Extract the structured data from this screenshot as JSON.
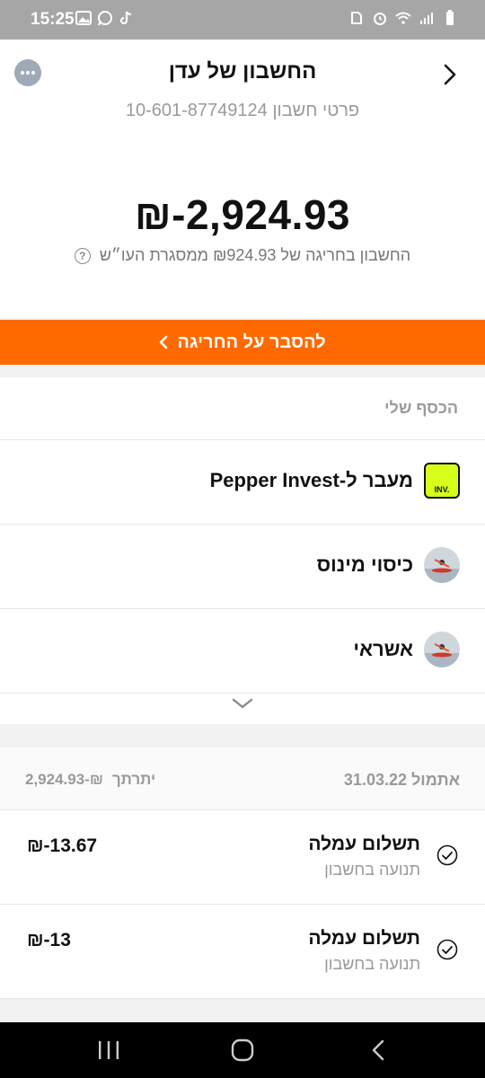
{
  "status_bar": {
    "time": "15:25",
    "left_icons": [
      "gallery-icon",
      "whatsapp-icon",
      "tiktok-icon"
    ],
    "right_icons": [
      "save-icon",
      "alarm-icon",
      "wifi-icon",
      "signal-icon",
      "battery-icon"
    ]
  },
  "header": {
    "title": "החשבון של עדן",
    "subtitle": "פרטי חשבון 10-601-87749124"
  },
  "balance": {
    "amount": "₪-2,924.93",
    "overdraft_text": "החשבון בחריגה של ₪924.93 ממסגרת העו״ש"
  },
  "cta": {
    "label": "להסבר על החריגה"
  },
  "my_money": {
    "title": "הכסף שלי",
    "items": [
      {
        "label": "מעבר ל-Pepper Invest",
        "icon_text": "INV."
      },
      {
        "label": "כיסוי מינוס"
      },
      {
        "label": "אשראי"
      }
    ]
  },
  "transactions": {
    "date": "אתמול 31.03.22",
    "balance_label": "יתרתך",
    "balance_value": "₪-2,924.93",
    "rows": [
      {
        "title": "תשלום עמלה",
        "subtitle": "תנועה בחשבון",
        "amount": "₪-13.67"
      },
      {
        "title": "תשלום עמלה",
        "subtitle": "תנועה בחשבון",
        "amount": "₪-13"
      }
    ]
  },
  "colors": {
    "accent": "#ff6a00",
    "inv_badge": "#d6ff1a",
    "muted_text": "#999999"
  }
}
